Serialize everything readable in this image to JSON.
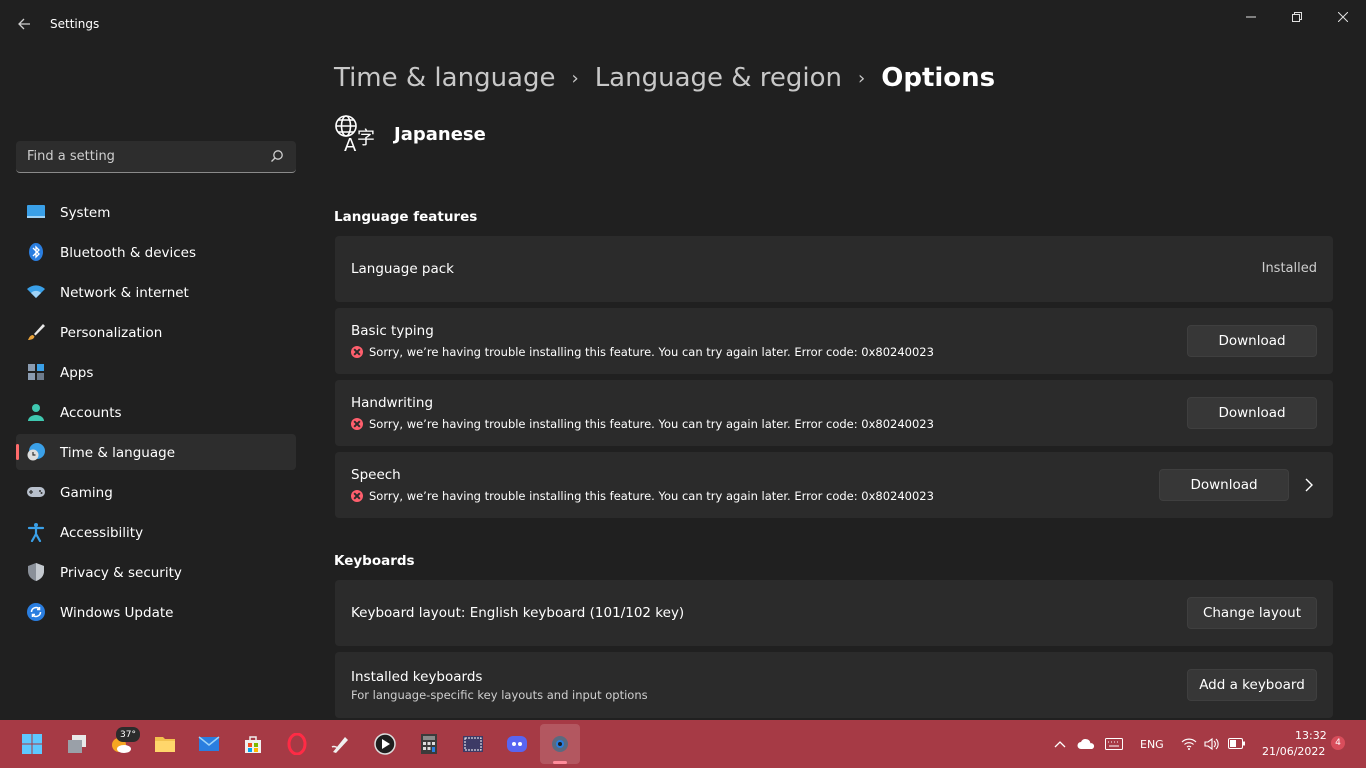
{
  "window": {
    "title": "Settings"
  },
  "search": {
    "placeholder": "Find a setting"
  },
  "sidebar": {
    "items": [
      {
        "label": "System",
        "icon": "display-icon"
      },
      {
        "label": "Bluetooth & devices",
        "icon": "bluetooth-icon"
      },
      {
        "label": "Network & internet",
        "icon": "wifi-icon"
      },
      {
        "label": "Personalization",
        "icon": "brush-icon"
      },
      {
        "label": "Apps",
        "icon": "apps-icon"
      },
      {
        "label": "Accounts",
        "icon": "person-icon"
      },
      {
        "label": "Time & language",
        "icon": "globe-clock-icon",
        "active": true
      },
      {
        "label": "Gaming",
        "icon": "controller-icon"
      },
      {
        "label": "Accessibility",
        "icon": "accessibility-icon"
      },
      {
        "label": "Privacy & security",
        "icon": "shield-icon"
      },
      {
        "label": "Windows Update",
        "icon": "update-icon"
      }
    ]
  },
  "breadcrumb": {
    "items": [
      "Time & language",
      "Language & region"
    ],
    "current": "Options"
  },
  "language": {
    "name": "Japanese",
    "icon": "language-icon"
  },
  "language_features": {
    "title": "Language features",
    "items": [
      {
        "title": "Language pack",
        "status": "Installed"
      },
      {
        "title": "Basic typing",
        "error": "Sorry, we’re having trouble installing this feature. You can try again later. Error code: 0x80240023",
        "action": "Download"
      },
      {
        "title": "Handwriting",
        "error": "Sorry, we’re having trouble installing this feature. You can try again later. Error code: 0x80240023",
        "action": "Download"
      },
      {
        "title": "Speech",
        "error": "Sorry, we’re having trouble installing this feature. You can try again later. Error code: 0x80240023",
        "action": "Download"
      }
    ]
  },
  "keyboards": {
    "title": "Keyboards",
    "layout": {
      "title": "Keyboard layout: English keyboard (101/102 key)",
      "action": "Change layout"
    },
    "installed": {
      "title": "Installed keyboards",
      "description": "For language-specific key layouts and input options",
      "action": "Add a keyboard"
    }
  },
  "taskbar": {
    "weather": "37°",
    "lang": "ENG",
    "time": "13:32",
    "date": "21/06/2022",
    "notifications": "4",
    "accent": "#a63a45"
  }
}
